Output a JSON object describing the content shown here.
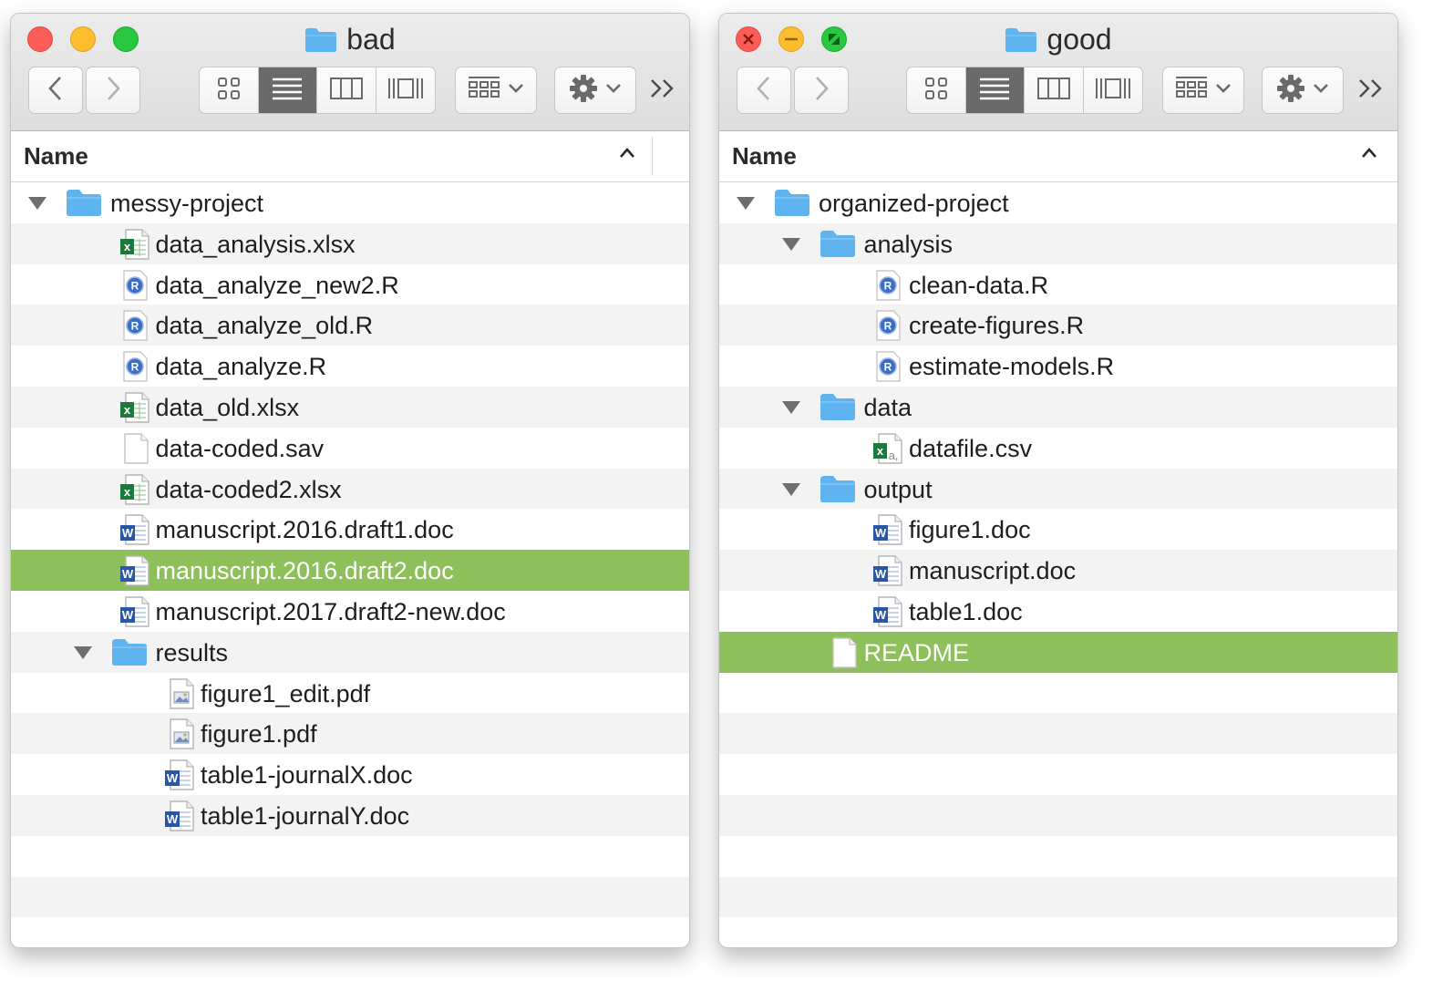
{
  "colors": {
    "selection": "#8dc05a",
    "folder": "#5fb4ef",
    "stripe": "#f3f3f3"
  },
  "left_window": {
    "title": "bad",
    "column_header": "Name",
    "rows": [
      {
        "depth": 0,
        "icon": "folder",
        "disclosure": "expanded",
        "name": "messy-project"
      },
      {
        "depth": 1,
        "icon": "excel",
        "name": "data_analysis.xlsx"
      },
      {
        "depth": 1,
        "icon": "r-script",
        "name": "data_analyze_new2.R"
      },
      {
        "depth": 1,
        "icon": "r-script",
        "name": "data_analyze_old.R"
      },
      {
        "depth": 1,
        "icon": "r-script",
        "name": "data_analyze.R"
      },
      {
        "depth": 1,
        "icon": "excel",
        "name": "data_old.xlsx"
      },
      {
        "depth": 1,
        "icon": "blank",
        "name": "data-coded.sav"
      },
      {
        "depth": 1,
        "icon": "excel",
        "name": "data-coded2.xlsx"
      },
      {
        "depth": 1,
        "icon": "word",
        "name": "manuscript.2016.draft1.doc"
      },
      {
        "depth": 1,
        "icon": "word",
        "name": "manuscript.2016.draft2.doc",
        "selected": true
      },
      {
        "depth": 1,
        "icon": "word",
        "name": "manuscript.2017.draft2-new.doc"
      },
      {
        "depth": 1,
        "icon": "folder",
        "disclosure": "expanded",
        "name": "results"
      },
      {
        "depth": 2,
        "icon": "pdf",
        "name": "figure1_edit.pdf"
      },
      {
        "depth": 2,
        "icon": "pdf",
        "name": "figure1.pdf"
      },
      {
        "depth": 2,
        "icon": "word",
        "name": "table1-journalX.doc"
      },
      {
        "depth": 2,
        "icon": "word",
        "name": "table1-journalY.doc"
      }
    ]
  },
  "right_window": {
    "title": "good",
    "column_header": "Name",
    "rows": [
      {
        "depth": 0,
        "icon": "folder",
        "disclosure": "expanded",
        "name": "organized-project"
      },
      {
        "depth": 1,
        "icon": "folder",
        "disclosure": "expanded",
        "name": "analysis"
      },
      {
        "depth": 2,
        "icon": "r-script",
        "name": "clean-data.R"
      },
      {
        "depth": 2,
        "icon": "r-script",
        "name": "create-figures.R"
      },
      {
        "depth": 2,
        "icon": "r-script",
        "name": "estimate-models.R"
      },
      {
        "depth": 1,
        "icon": "folder",
        "disclosure": "expanded",
        "name": "data"
      },
      {
        "depth": 2,
        "icon": "csv",
        "name": "datafile.csv"
      },
      {
        "depth": 1,
        "icon": "folder",
        "disclosure": "expanded",
        "name": "output"
      },
      {
        "depth": 2,
        "icon": "word",
        "name": "figure1.doc"
      },
      {
        "depth": 2,
        "icon": "word",
        "name": "manuscript.doc"
      },
      {
        "depth": 2,
        "icon": "word",
        "name": "table1.doc"
      },
      {
        "depth": 1,
        "icon": "blank",
        "name": "README",
        "selected": true
      }
    ]
  }
}
